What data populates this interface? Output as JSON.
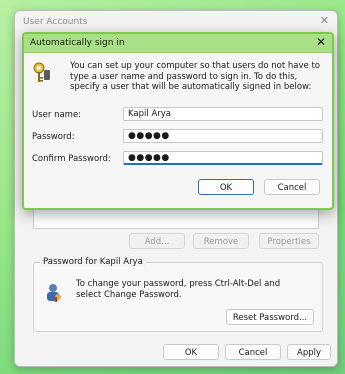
{
  "back_window": {
    "title": "User Accounts",
    "close_glyph": "✕",
    "buttons": {
      "add": "Add...",
      "remove": "Remove",
      "properties": "Properties"
    },
    "group": {
      "title": "Password for Kapil Arya",
      "text": "To change your password, press Ctrl-Alt-Del and select Change Password.",
      "reset_button": "Reset Password..."
    },
    "footer": {
      "ok": "OK",
      "cancel": "Cancel",
      "apply": "Apply"
    }
  },
  "dialog": {
    "title": "Automatically sign in",
    "close_glyph": "✕",
    "description": "You can set up your computer so that users do not have to type a user name and password to sign in. To do this, specify a user that will be automatically signed in below:",
    "fields": {
      "username": {
        "label": "User name:",
        "value": "Kapil Arya"
      },
      "password": {
        "label": "Password:",
        "value": "●●●●●"
      },
      "confirm": {
        "label": "Confirm Password:",
        "value": "●●●●●"
      }
    },
    "buttons": {
      "ok": "OK",
      "cancel": "Cancel"
    }
  },
  "colors": {
    "accent_green": "#a9df87",
    "focus_blue": "#1a73c9"
  }
}
